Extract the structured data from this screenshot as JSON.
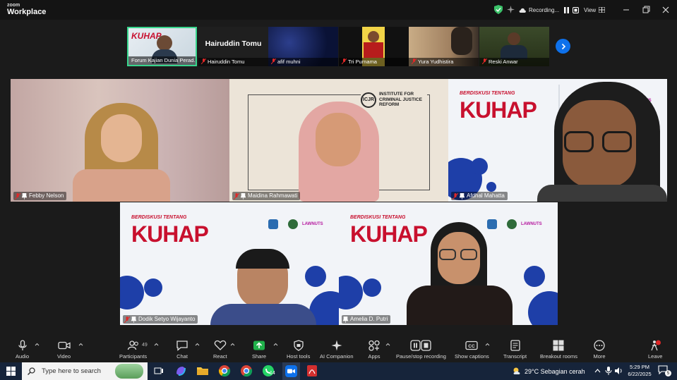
{
  "app": {
    "logo_top": "zoom",
    "logo_bottom": "Workplace"
  },
  "titlebar": {
    "recording_label": "Recording...",
    "view_label": "View"
  },
  "thumbnails": [
    {
      "name": "Forum Kajian Dunia Perad...",
      "big_name": ""
    },
    {
      "name": "Hairuddin Tomu",
      "big_name": "Hairuddin Tomu"
    },
    {
      "name": "afif muhni",
      "big_name": ""
    },
    {
      "name": "Tri Purnama",
      "big_name": ""
    },
    {
      "name": "Yura Yudhistira",
      "big_name": ""
    },
    {
      "name": "Reski Anwar",
      "big_name": ""
    }
  ],
  "banner": {
    "small": "BERDISKUSI TENTANG",
    "big": "KUHAP",
    "brand": "LAWNUTS"
  },
  "icjr": {
    "abbr": "ICJR",
    "line1": "INSTITUTE FOR",
    "line2": "CRIMINAL JUSTICE",
    "line3": "REFORM"
  },
  "tiles": [
    {
      "name": "Febby Nelson"
    },
    {
      "name": "Maidina Rahmawati"
    },
    {
      "name": "Afdhal Mahatta"
    },
    {
      "name": "Dodik Setyo Wijayanto"
    },
    {
      "name": "Amelia D. Putri"
    }
  ],
  "toolbar": {
    "audio": "Audio",
    "video": "Video",
    "participants": "Participants",
    "participants_count": "49",
    "chat": "Chat",
    "react": "React",
    "share": "Share",
    "host_tools": "Host tools",
    "ai_companion": "AI Companion",
    "apps": "Apps",
    "pause_stop": "Pause/stop recording",
    "captions": "Show captions",
    "transcript": "Transcript",
    "breakout": "Breakout rooms",
    "more": "More",
    "leave": "Leave"
  },
  "taskbar": {
    "search_placeholder": "Type here to search",
    "whatsapp_badge": "14",
    "weather": "29°C  Sebagian cerah",
    "time": "5:29 PM",
    "date": "6/22/2025",
    "notif_count": "5"
  },
  "colors": {
    "accent": "#0e71eb",
    "active_border": "#38d68d",
    "recording_red": "#e02828",
    "kuhap_red": "#c8102e"
  }
}
